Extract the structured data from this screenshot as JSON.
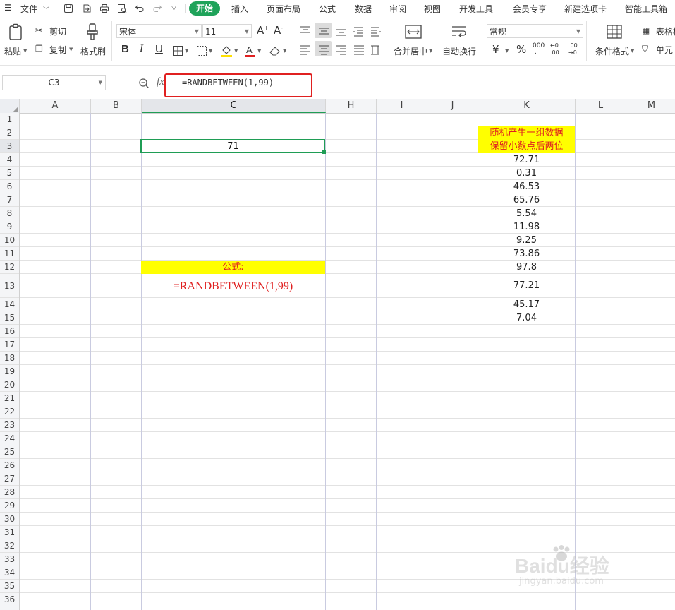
{
  "menubar": {
    "file_label": "文件",
    "tabs": [
      "开始",
      "插入",
      "页面布局",
      "公式",
      "数据",
      "审阅",
      "视图",
      "开发工具",
      "会员专享",
      "新建选项卡",
      "智能工具箱"
    ],
    "active_tab": "开始"
  },
  "ribbon": {
    "paste": "粘贴",
    "cut": "剪切",
    "copy": "复制",
    "format_painter": "格式刷",
    "font_name": "宋体",
    "font_size": "11",
    "bold": "B",
    "italic": "I",
    "underline": "U",
    "merge_center": "合并居中",
    "wrap_text": "自动换行",
    "number_format": "常规",
    "currency_symbol": "¥",
    "percent_symbol": "%",
    "conditional_format": "条件格式",
    "table_style": "表格样",
    "cell_style": "单元"
  },
  "formula_bar": {
    "name_box": "C3",
    "fx": "fx",
    "formula": "=RANDBETWEEN(1,99)"
  },
  "columns": [
    "A",
    "B",
    "C",
    "H",
    "I",
    "J",
    "K",
    "L",
    "M"
  ],
  "selected_column": "C",
  "rows": [
    "1",
    "2",
    "3",
    "4",
    "5",
    "6",
    "7",
    "8",
    "9",
    "10",
    "11",
    "12",
    "13",
    "14",
    "15",
    "16",
    "17",
    "18",
    "19",
    "20",
    "21",
    "22",
    "23",
    "24",
    "25",
    "26",
    "27",
    "28",
    "29",
    "30",
    "31",
    "32",
    "33",
    "34",
    "35",
    "36"
  ],
  "selected_row": "3",
  "cells": {
    "C3": "71",
    "C12": "公式:",
    "C13": "=RANDBETWEEN(1,99)",
    "K2": "随机产生一组数据",
    "K3": "保留小数点后两位",
    "K_values": [
      "72.71",
      "0.31",
      "46.53",
      "65.76",
      "5.54",
      "11.98",
      "9.25",
      "73.86",
      "97.8",
      "77.21",
      "45.17",
      "7.04"
    ]
  },
  "watermark": {
    "brand": "Baidu经验",
    "url": "jingyan.baidu.com"
  },
  "colors": {
    "accent_green": "#1fa35a",
    "highlight_yellow": "#ffff00",
    "red_text": "#e02020",
    "selection_border": "#1f9d55"
  }
}
